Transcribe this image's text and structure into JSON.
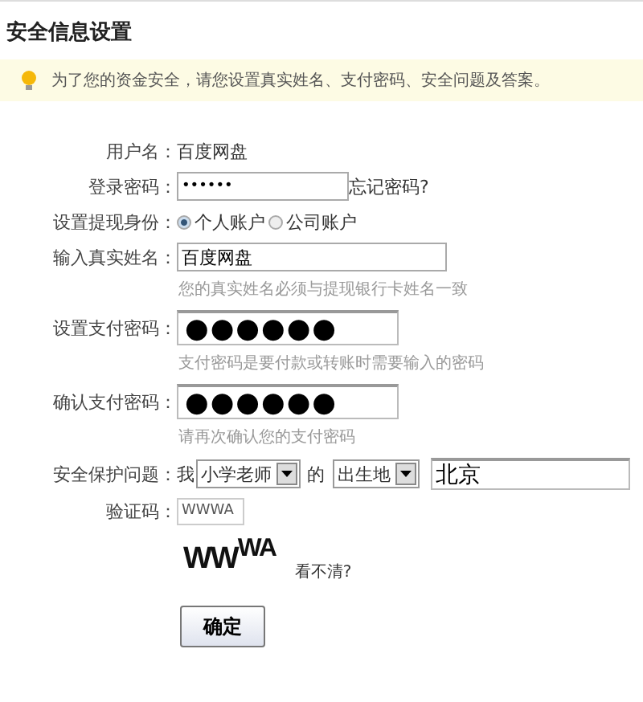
{
  "title": "安全信息设置",
  "notice": "为了您的资金安全，请您设置真实姓名、支付密码、安全问题及答案。",
  "username": {
    "label": "用户名：",
    "value": "百度网盘"
  },
  "login_password": {
    "label": "登录密码：",
    "value": "••••••",
    "link": "忘记密码?"
  },
  "identity": {
    "label": "设置提现身份：",
    "options": [
      {
        "label": "个人账户",
        "selected": true
      },
      {
        "label": "公司账户",
        "selected": false
      }
    ]
  },
  "real_name": {
    "label": "输入真实姓名：",
    "value": "百度网盘",
    "hint": "您的真实姓名必须与提现银行卡姓名一致"
  },
  "pay_password": {
    "label": "设置支付密码：",
    "value": "●●●●●●",
    "hint": "支付密码是要付款或转账时需要输入的密码"
  },
  "confirm_password": {
    "label": "确认支付密码：",
    "value": "●●●●●●",
    "hint": "请再次确认您的支付密码"
  },
  "security_question": {
    "label": "安全保护问题：",
    "prefix": "我",
    "person": "小学老师",
    "joiner": "的",
    "attribute": "出生地",
    "answer": "北京"
  },
  "captcha": {
    "label": "验证码：",
    "value": "WWWA",
    "image_text": "WW$^{WA}$",
    "refresh": "看不清?"
  },
  "submit": "确定"
}
